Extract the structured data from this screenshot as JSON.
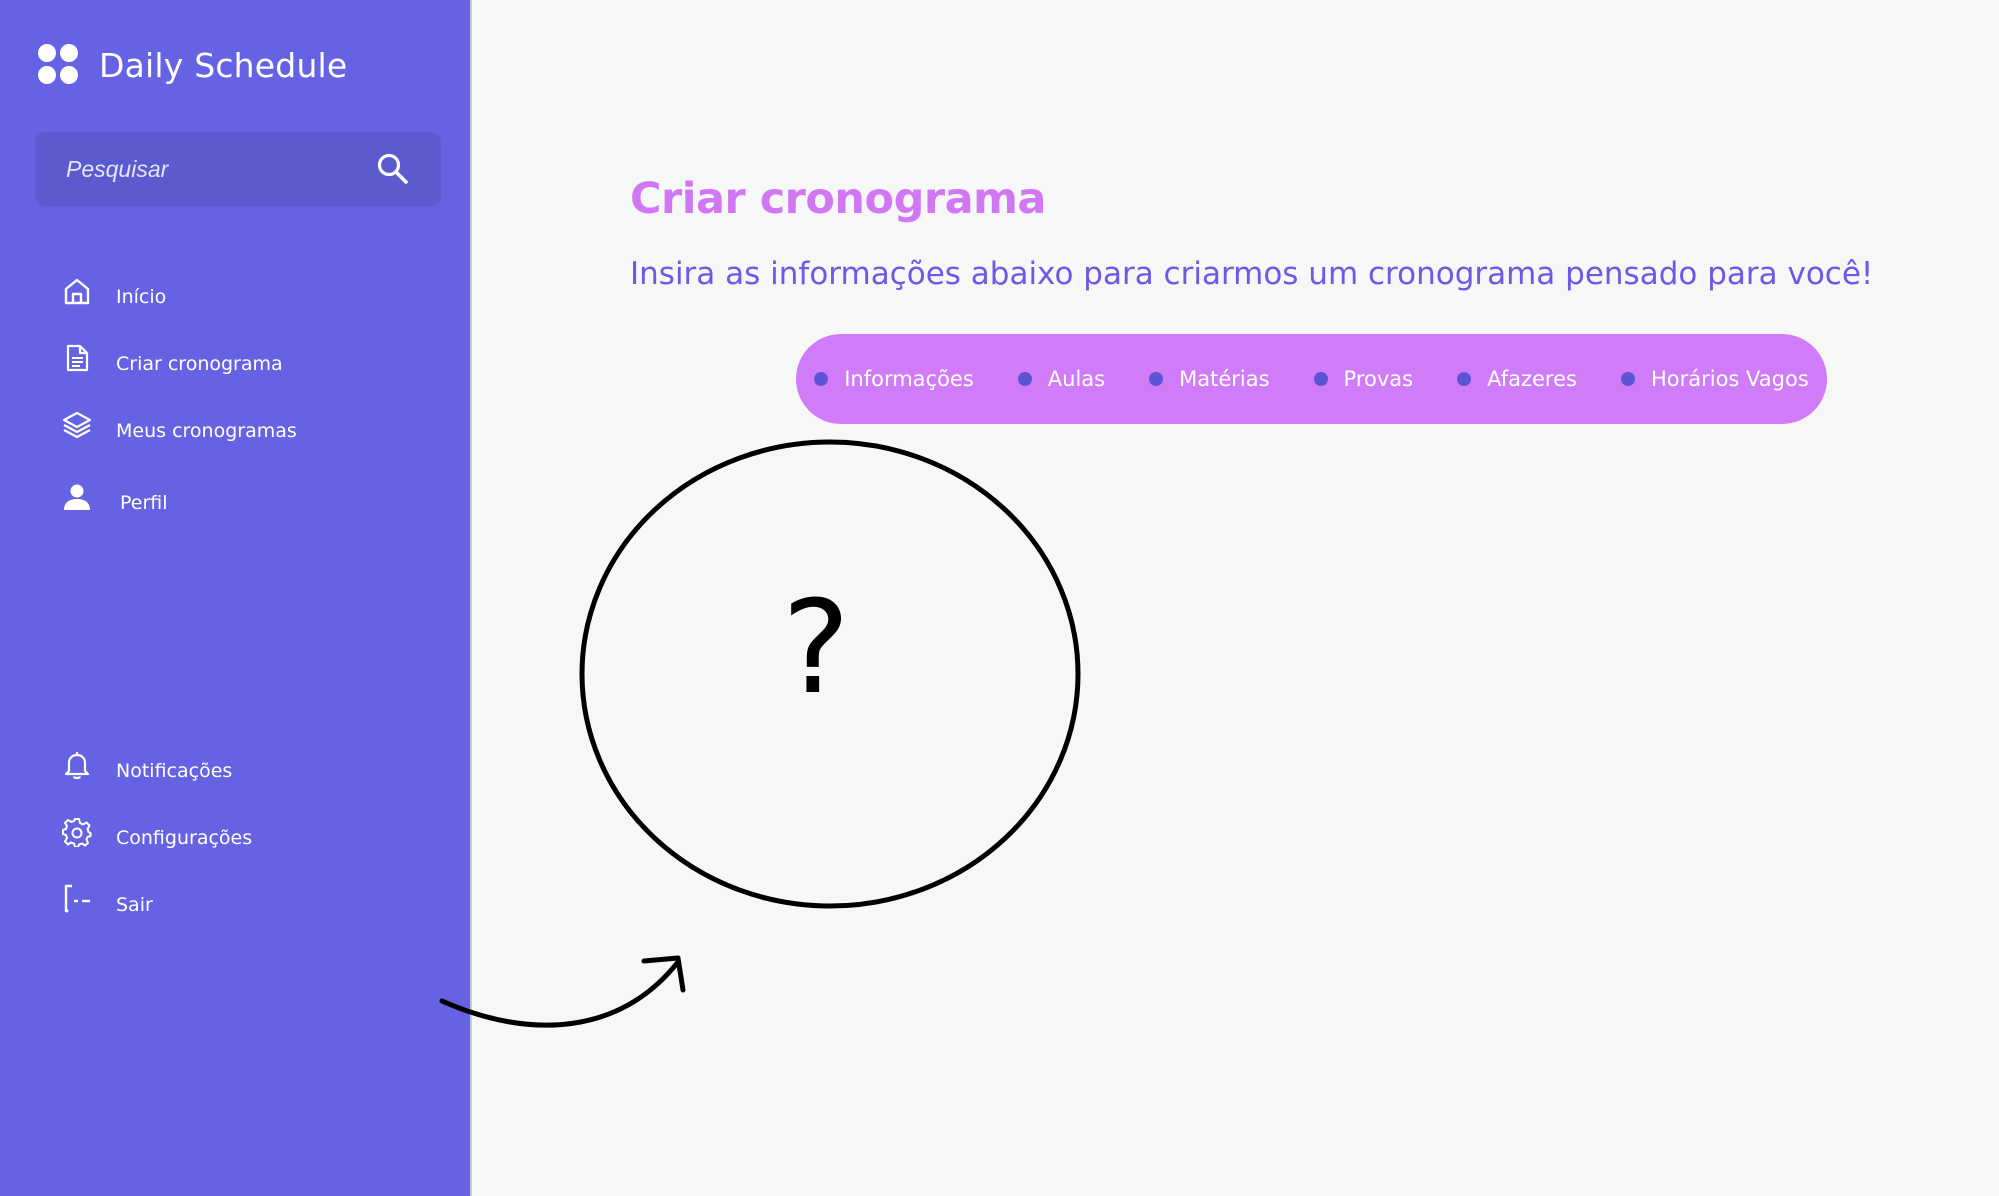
{
  "app": {
    "title": "Daily Schedule"
  },
  "search": {
    "placeholder": "Pesquisar"
  },
  "sidebar": {
    "main_items": [
      {
        "label": "Início",
        "icon": "home-icon"
      },
      {
        "label": "Criar cronograma",
        "icon": "document-icon"
      },
      {
        "label": "Meus cronogramas",
        "icon": "layers-icon"
      },
      {
        "label": "Perfil",
        "icon": "user-icon"
      }
    ],
    "bottom_items": [
      {
        "label": "Notificações",
        "icon": "bell-icon"
      },
      {
        "label": "Configurações",
        "icon": "gear-icon"
      },
      {
        "label": "Sair",
        "icon": "logout-icon"
      }
    ]
  },
  "main": {
    "title": "Criar cronograma",
    "subtitle": "Insira as informações abaixo para criarmos um cronograma pensado para você!",
    "steps": [
      {
        "label": "Informações"
      },
      {
        "label": "Aulas"
      },
      {
        "label": "Matérias"
      },
      {
        "label": "Provas"
      },
      {
        "label": "Afazeres"
      },
      {
        "label": "Horários Vagos"
      }
    ],
    "illustration": {
      "symbol": "?"
    }
  },
  "colors": {
    "sidebar_bg": "#6563E3",
    "search_bg": "#5B5BCF",
    "page_bg": "#F6F7F7",
    "title": "#D277F4",
    "subtitle": "#7058E6",
    "steps_bg": "#D07BF7",
    "step_dot": "#5B55D6"
  }
}
